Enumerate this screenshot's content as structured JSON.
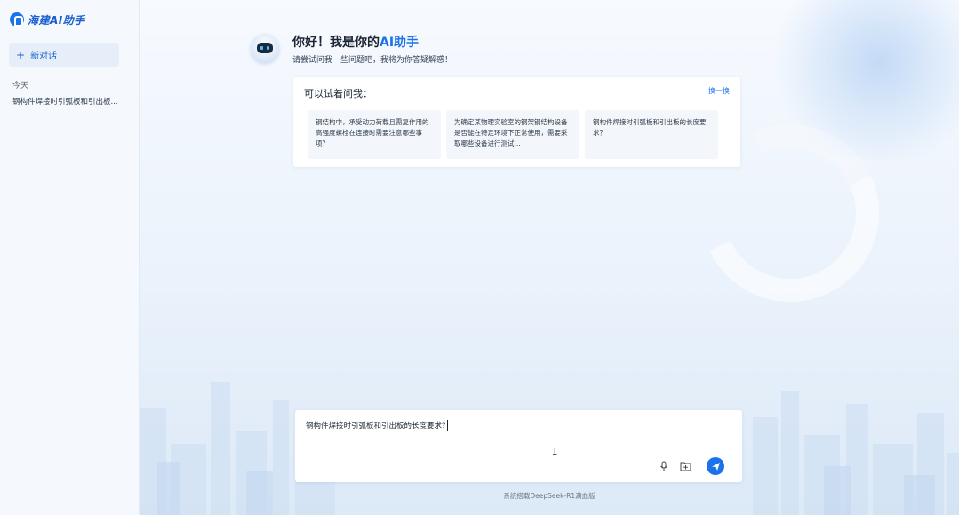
{
  "sidebar": {
    "logo_text": "海建AI助手",
    "new_chat_label": "新对话",
    "new_chat_icon": "+",
    "section_today": "今天",
    "history": [
      {
        "title": "钢构件焊接时引弧板和引出板..."
      }
    ]
  },
  "main": {
    "greeting_prefix": "你好！我是你的",
    "greeting_accent": "AI助手",
    "subtitle": "请尝试问我一些问题吧，我将为你答疑解惑！",
    "suggest": {
      "title": "可以试着问我：",
      "refresh_label": "换一换",
      "questions": [
        {
          "text": "钢结构中，承受动力荷载且需复作用的高强度螺栓在连接时需要注意哪些事项？"
        },
        {
          "text": "为确定某物理实验室的钢架钢结构设备是否能在特定环境下正常使用，需要采取哪些设备进行测试..."
        },
        {
          "text": "钢构件焊接时引弧板和引出板的长度要求？"
        }
      ]
    },
    "input": {
      "value": "钢构件焊接时引弧板和引出板的长度要求？"
    },
    "footer": "系统搭载DeepSeek-R1满血版"
  },
  "colors": {
    "accent": "#1a73e8",
    "sidebar_bg": "#f5f8fc",
    "card_bg": "#ffffff"
  },
  "icons": {
    "mic": "microphone-icon",
    "file": "file-upload-icon",
    "send": "send-icon"
  }
}
